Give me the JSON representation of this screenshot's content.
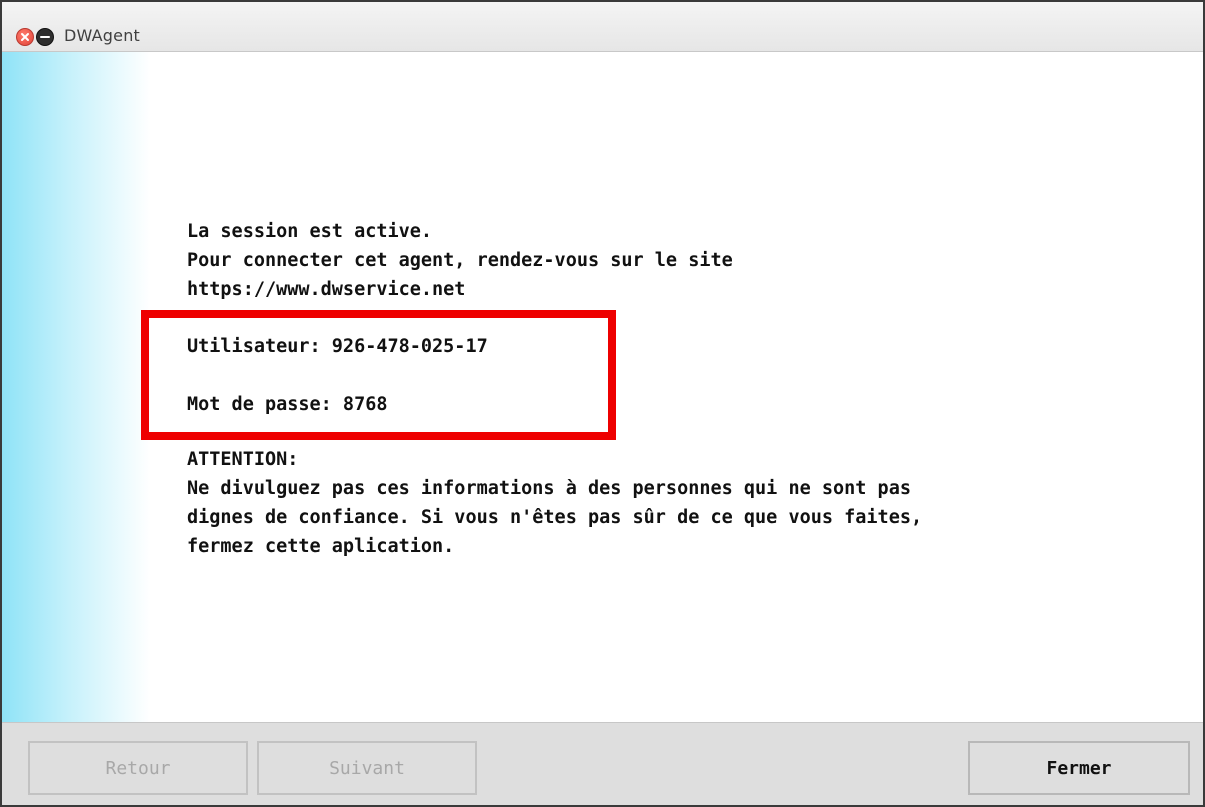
{
  "window": {
    "title": "DWAgent"
  },
  "message": {
    "status_line": "La session est active.",
    "connect_line": "Pour connecter cet agent, rendez-vous sur le site",
    "url_line": "https://www.dwservice.net",
    "user_line": "Utilisateur: 926-478-025-17",
    "password_line": "Mot de passe: 8768",
    "warning_title": "ATTENTION:",
    "warning_line1": "Ne divulguez pas ces informations à des personnes qui ne sont pas",
    "warning_line2": "dignes de confiance. Si vous n'êtes pas sûr de ce que vous faites,",
    "warning_line3": "fermez cette aplication."
  },
  "buttons": {
    "back_label": "Retour",
    "next_label": "Suivant",
    "close_label": "Fermer"
  },
  "colors": {
    "highlight": "#ee0000",
    "accent_band": "#8fe3f7",
    "close_button": "#e0443a"
  },
  "icons": {
    "close": "close-icon",
    "minimize": "minimize-icon"
  }
}
